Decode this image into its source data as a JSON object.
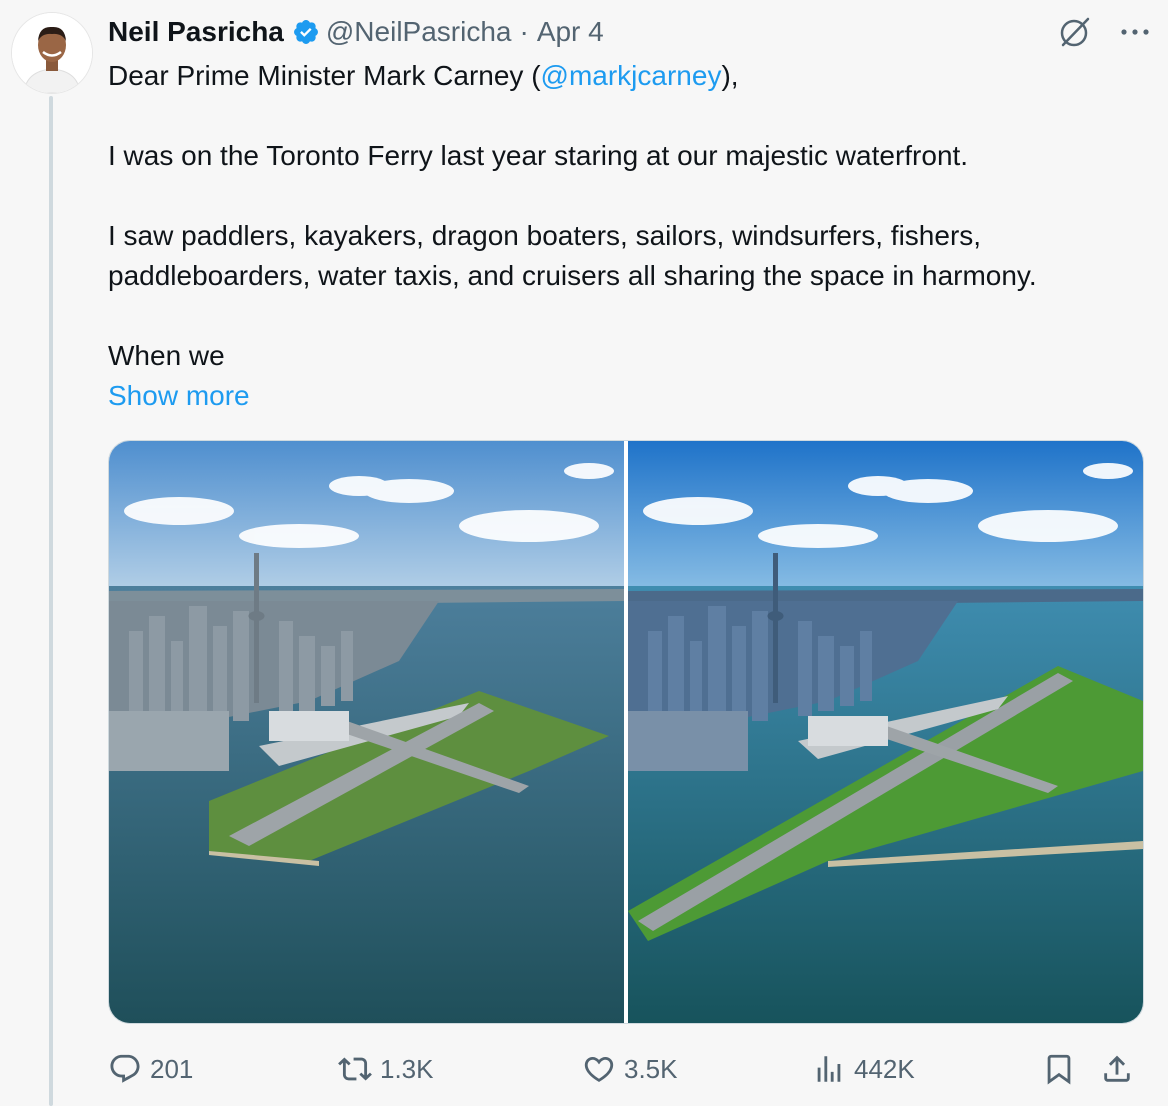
{
  "tweet": {
    "display_name": "Neil Pasricha",
    "handle": "@NeilPasricha",
    "separator": "·",
    "date": "Apr 4",
    "verified": true,
    "text": {
      "line1_before": "Dear Prime Minister Mark Carney (",
      "mention": "@markjcarney",
      "line1_after": "),",
      "para2": "I was on the Toronto Ferry last year staring at our majestic waterfront.",
      "para3": "I saw paddlers, kayakers, dragon boaters, sailors, windsurfers, fishers, paddleboarders, water taxis, and cruisers all sharing the space in harmony.",
      "para4": "When we"
    },
    "show_more": "Show more",
    "media": [
      {
        "icon": "aerial-photo-toronto-island-airport-current"
      },
      {
        "icon": "aerial-photo-toronto-island-airport-extended-runway"
      }
    ],
    "stats": {
      "replies": "201",
      "reposts": "1.3K",
      "likes": "3.5K",
      "views": "442K"
    }
  },
  "colors": {
    "accent": "#1d9bf0",
    "secondary_text": "#536471",
    "primary_text": "#0f1419",
    "background": "#f7f7f7"
  },
  "icons": {
    "header": [
      "grok-icon",
      "more-icon"
    ],
    "actions": [
      "reply-icon",
      "repost-icon",
      "like-icon",
      "views-icon",
      "bookmark-icon",
      "share-icon"
    ]
  }
}
